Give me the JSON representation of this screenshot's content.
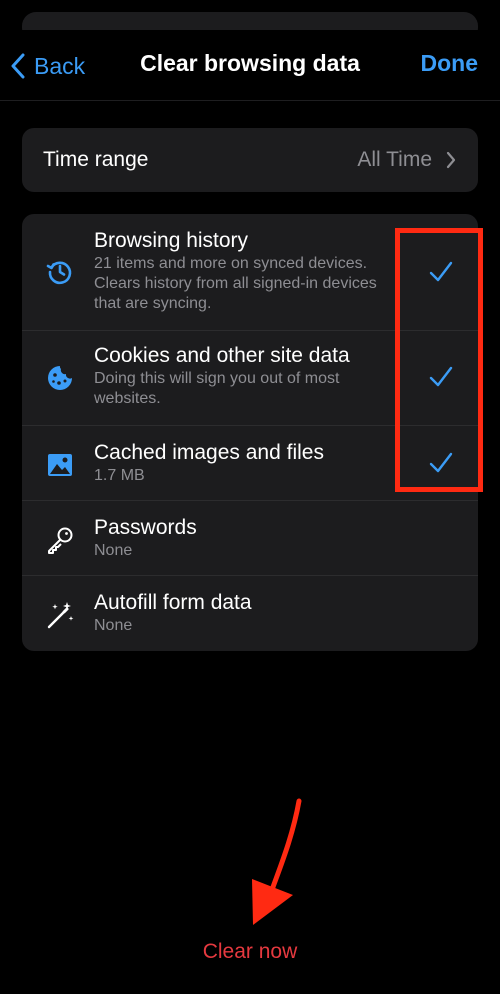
{
  "nav": {
    "back_label": "Back",
    "title": "Clear browsing data",
    "done_label": "Done"
  },
  "time_range": {
    "label": "Time range",
    "value": "All Time"
  },
  "items": [
    {
      "title": "Browsing history",
      "subtitle": "21 items and more on synced devices. Clears history from all signed-in devices that are syncing.",
      "icon": "history-icon",
      "checked": true
    },
    {
      "title": "Cookies and other site data",
      "subtitle": "Doing this will sign you out of most websites.",
      "icon": "cookie-icon",
      "checked": true
    },
    {
      "title": "Cached images and files",
      "subtitle": "1.7 MB",
      "icon": "image-icon",
      "checked": true
    },
    {
      "title": "Passwords",
      "subtitle": "None",
      "icon": "key-icon",
      "checked": false
    },
    {
      "title": "Autofill form data",
      "subtitle": "None",
      "icon": "magic-wand-icon",
      "checked": false
    }
  ],
  "clear_now_label": "Clear now",
  "colors": {
    "accent": "#3b9cf6",
    "destructive": "#e5393f",
    "annotation": "#ff2a12",
    "background": "#000000",
    "card": "#1c1c1e"
  }
}
